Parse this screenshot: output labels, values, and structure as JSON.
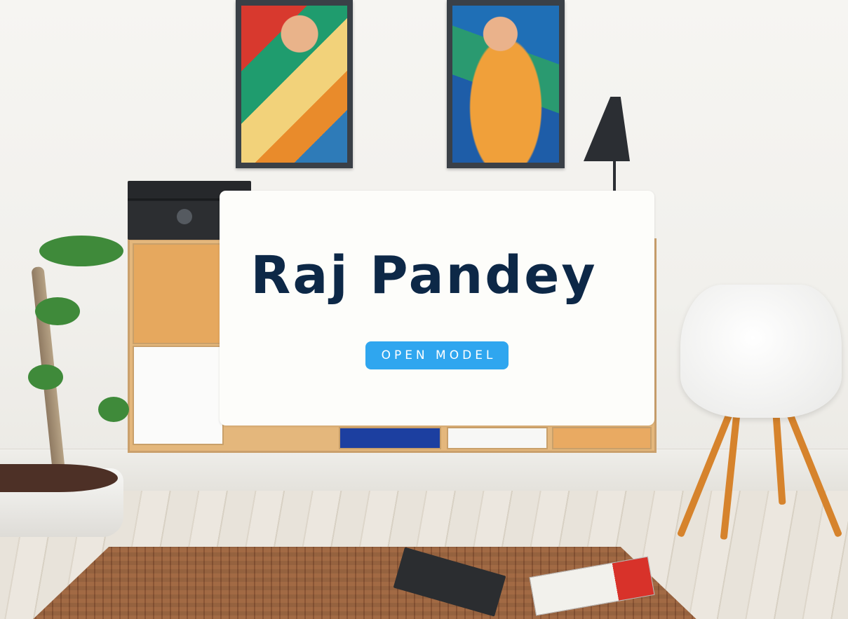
{
  "hero": {
    "name": "Raj Pandey",
    "button_label": "OPEN MODEL"
  },
  "colors": {
    "title_color": "#0d2847",
    "button_color": "#2fa6ef",
    "card_background": "#fdfdfa"
  },
  "background_image": "living-room-photo"
}
